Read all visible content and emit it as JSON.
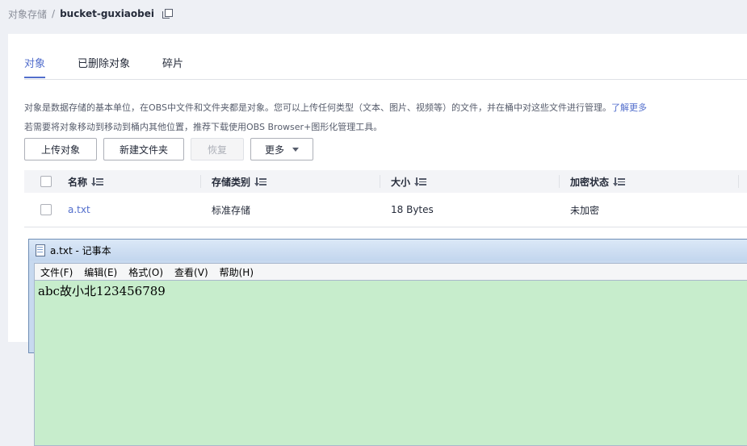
{
  "breadcrumb": {
    "parent": "对象存储",
    "separator": "/",
    "current": "bucket-guxiaobei"
  },
  "tabs": [
    "对象",
    "已删除对象",
    "碎片"
  ],
  "description": {
    "line1": "对象是数据存储的基本单位，在OBS中文件和文件夹都是对象。您可以上传任何类型（文本、图片、视频等）的文件，并在桶中对这些文件进行管理。",
    "link": "了解更多",
    "line2": "若需要将对象移动到移动到桶内其他位置，推荐下载使用OBS Browser+图形化管理工具。"
  },
  "toolbar": {
    "upload": "上传对象",
    "new_folder": "新建文件夹",
    "restore": "恢复",
    "more": "更多"
  },
  "table": {
    "headers": [
      "名称",
      "存储类别",
      "大小",
      "加密状态"
    ],
    "rows": [
      {
        "name": "a.txt",
        "storage_class": "标准存储",
        "size": "18 Bytes",
        "encryption": "未加密"
      }
    ]
  },
  "notepad": {
    "title": "a.txt - 记事本",
    "menu": [
      "文件(F)",
      "编辑(E)",
      "格式(O)",
      "查看(V)",
      "帮助(H)"
    ],
    "content": "abc故小北123456789"
  }
}
